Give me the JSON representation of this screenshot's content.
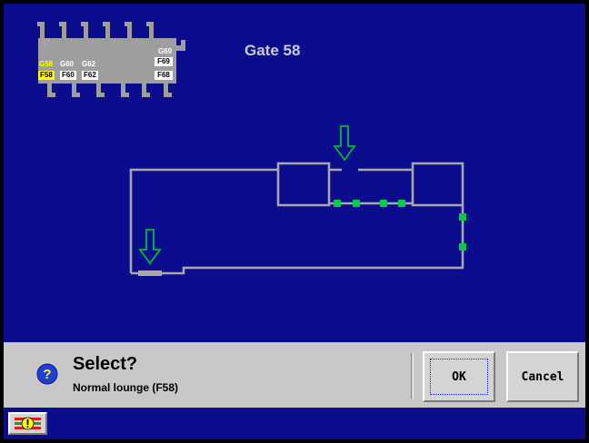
{
  "header": {
    "title": "Gate 58"
  },
  "minimap": {
    "section_letter": "F",
    "gates_top": [
      "G58",
      "G60",
      "G62"
    ],
    "gate_right_top": "G69",
    "boxes": {
      "selected": "F58",
      "f60": "F60",
      "f62": "F62",
      "f69": "F69",
      "f68": "F68"
    },
    "colors": {
      "body": "#9e9e9e",
      "selected": "#ffff00",
      "selected_label": "#ffff00"
    }
  },
  "diagram": {
    "line_color": "#a9a9a9",
    "node_color": "#00cc44",
    "arrow_color": "#00bb33"
  },
  "dialog": {
    "icon": "question-icon",
    "title": "Select?",
    "message": "Normal lounge (F58)",
    "ok_label": "OK",
    "cancel_label": "Cancel"
  },
  "bottom_bar": {
    "warning_icon": "warning-flag-icon"
  }
}
